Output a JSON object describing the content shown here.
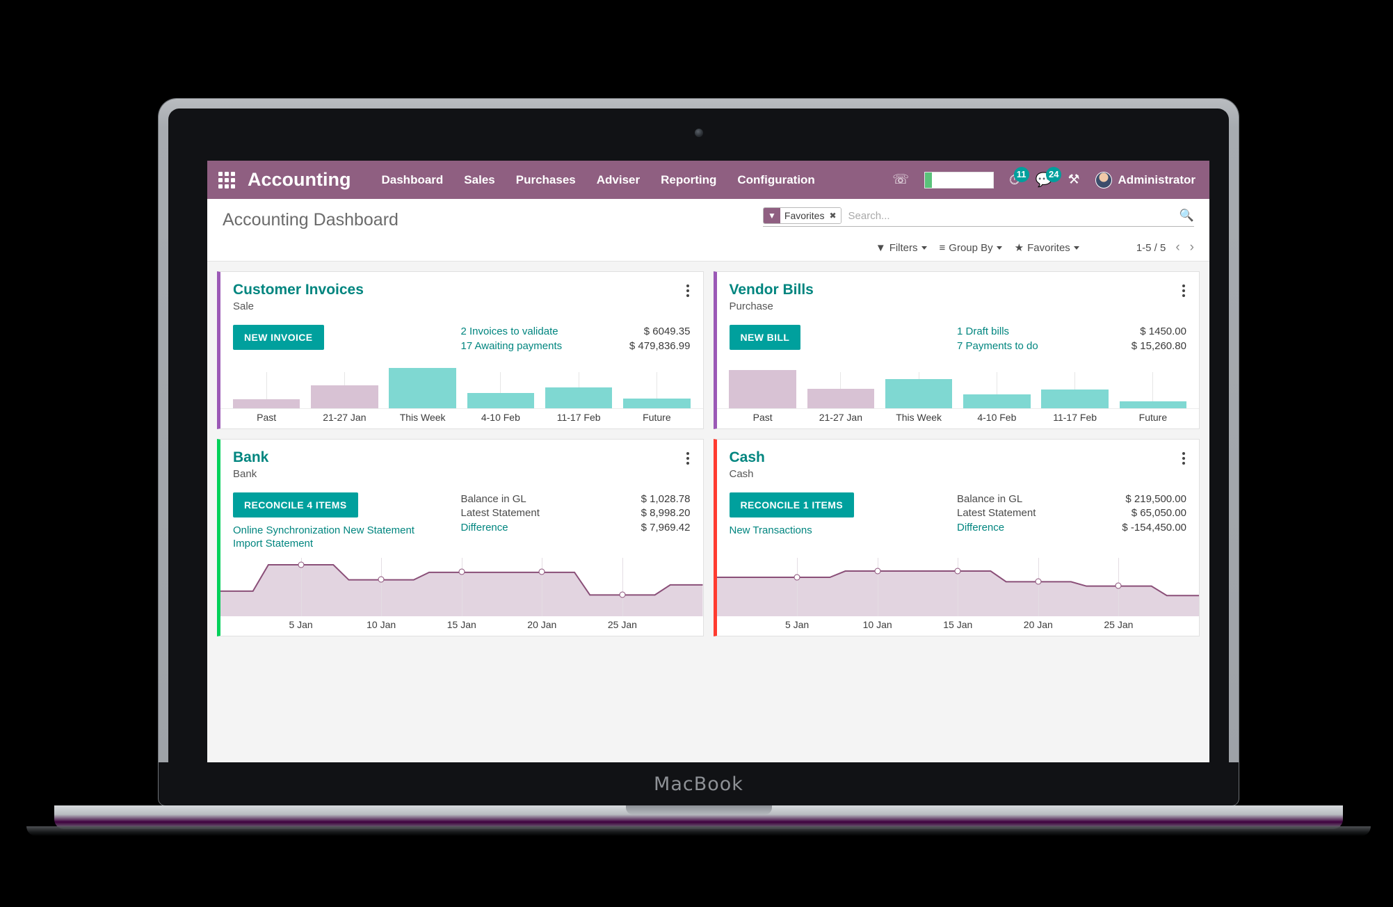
{
  "device": {
    "label": "MacBook"
  },
  "navbar": {
    "apps_icon": "grid-apps-icon",
    "brand": "Accounting",
    "menu": [
      {
        "label": "Dashboard"
      },
      {
        "label": "Sales"
      },
      {
        "label": "Purchases"
      },
      {
        "label": "Adviser"
      },
      {
        "label": "Reporting"
      },
      {
        "label": "Configuration"
      }
    ],
    "phone_icon": "✆",
    "activities_badge": "11",
    "messages_badge": "24",
    "tools_icon": "⚒",
    "user_name": "Administrator",
    "accent_color": "#8f5f81",
    "badge_color": "#00a09d"
  },
  "control_panel": {
    "page_title": "Accounting Dashboard",
    "facet_label": "Favorites",
    "facet_remove": "✖",
    "search_placeholder": "Search...",
    "search_value": "",
    "filters_label": "Filters",
    "group_by_label": "Group By",
    "favorites_label": "Favorites",
    "pager_count": "1-5 / 5",
    "prev_arrow": "‹",
    "next_arrow": "›"
  },
  "cards": [
    {
      "id": "customer-invoices",
      "title": "Customer Invoices",
      "subtitle": "Sale",
      "accent": "#9b59b6",
      "button": "NEW INVOICE",
      "links": [],
      "stats": [
        {
          "label": "2 Invoices to validate",
          "value": "$ 6049.35",
          "link": true
        },
        {
          "label": "17 Awaiting payments",
          "value": "$ 479,836.99",
          "link": true
        }
      ]
    },
    {
      "id": "vendor-bills",
      "title": "Vendor Bills",
      "subtitle": "Purchase",
      "accent": "#9b59b6",
      "button": "NEW BILL",
      "links": [],
      "stats": [
        {
          "label": "1 Draft bills",
          "value": "$ 1450.00",
          "link": true
        },
        {
          "label": "7 Payments to do",
          "value": "$ 15,260.80",
          "link": true
        }
      ]
    },
    {
      "id": "bank",
      "title": "Bank",
      "subtitle": "Bank",
      "accent": "#00d05a",
      "button": "RECONCILE 4 ITEMS",
      "links": [
        {
          "label": "Online Synchronization New Statement"
        },
        {
          "label": "Import Statement"
        }
      ],
      "stats": [
        {
          "label": "Balance in GL",
          "value": "$ 1,028.78",
          "link": false
        },
        {
          "label": "Latest Statement",
          "value": "$ 8,998.20",
          "link": false
        },
        {
          "label": "Difference",
          "value": "$ 7,969.42",
          "link": true
        }
      ]
    },
    {
      "id": "cash",
      "title": "Cash",
      "subtitle": "Cash",
      "accent": "#ff3b30",
      "button": "RECONCILE 1 ITEMS",
      "links": [
        {
          "label": "New Transactions"
        }
      ],
      "stats": [
        {
          "label": "Balance in GL",
          "value": "$ 219,500.00",
          "link": false
        },
        {
          "label": "Latest Statement",
          "value": "$ 65,050.00",
          "link": false
        },
        {
          "label": "Difference",
          "value": "$ -154,450.00",
          "link": true
        }
      ]
    }
  ],
  "chart_data": [
    {
      "id": "customer-invoices-chart",
      "type": "bar",
      "title": "Customer Invoices aging",
      "xlabel": "",
      "ylabel": "",
      "categories": [
        "Past",
        "21-27 Jan",
        "This Week",
        "4-10 Feb",
        "11-17 Feb",
        "Future"
      ],
      "values": [
        11,
        30,
        52,
        20,
        27,
        12
      ],
      "ylim": [
        0,
        60
      ],
      "grid": false,
      "legend": "none",
      "colors": [
        "#d8c2d4",
        "#d8c2d4",
        "#7fd8d2",
        "#7fd8d2",
        "#7fd8d2",
        "#7fd8d2"
      ],
      "series_kind": [
        "past",
        "past",
        "future",
        "future",
        "future",
        "future"
      ]
    },
    {
      "id": "vendor-bills-chart",
      "type": "bar",
      "title": "Vendor Bills aging",
      "xlabel": "",
      "ylabel": "",
      "categories": [
        "Past",
        "21-27 Jan",
        "This Week",
        "4-10 Feb",
        "11-17 Feb",
        "Future"
      ],
      "values": [
        50,
        25,
        38,
        18,
        24,
        9
      ],
      "ylim": [
        0,
        60
      ],
      "grid": false,
      "legend": "none",
      "colors": [
        "#d8c2d4",
        "#d8c2d4",
        "#7fd8d2",
        "#7fd8d2",
        "#7fd8d2",
        "#7fd8d2"
      ],
      "series_kind": [
        "past",
        "past",
        "future",
        "future",
        "future",
        "future"
      ]
    },
    {
      "id": "bank-chart",
      "type": "area",
      "title": "Bank balance evolution",
      "xlabel": "",
      "ylabel": "",
      "tick_labels": [
        "5 Jan",
        "10 Jan",
        "15 Jan",
        "20 Jan",
        "25 Jan"
      ],
      "x": [
        1,
        5,
        10,
        15,
        20,
        25,
        31
      ],
      "values": [
        40,
        82,
        58,
        70,
        70,
        34,
        50
      ],
      "marker_points": [
        {
          "x": "5 Jan",
          "y": 82
        },
        {
          "x": "10 Jan",
          "y": 58
        },
        {
          "x": "15 Jan",
          "y": 70
        },
        {
          "x": "20 Jan",
          "y": 70
        },
        {
          "x": "25 Jan",
          "y": 34
        }
      ],
      "ylim": [
        0,
        100
      ],
      "grid": true,
      "legend": "none",
      "line_color": "#8a4f78",
      "fill_color": "#e2d4e0"
    },
    {
      "id": "cash-chart",
      "type": "area",
      "title": "Cash balance evolution",
      "xlabel": "",
      "ylabel": "",
      "tick_labels": [
        "5 Jan",
        "10 Jan",
        "15 Jan",
        "20 Jan",
        "25 Jan"
      ],
      "x": [
        1,
        5,
        10,
        15,
        20,
        25,
        31
      ],
      "values": [
        62,
        62,
        72,
        72,
        55,
        48,
        33
      ],
      "marker_points": [
        {
          "x": "5 Jan",
          "y": 62
        },
        {
          "x": "10 Jan",
          "y": 72
        },
        {
          "x": "15 Jan",
          "y": 55
        },
        {
          "x": "20 Jan",
          "y": 48
        },
        {
          "x": "25 Jan",
          "y": 33
        }
      ],
      "ylim": [
        0,
        100
      ],
      "grid": true,
      "legend": "none",
      "line_color": "#8a4f78",
      "fill_color": "#e2d4e0"
    }
  ]
}
